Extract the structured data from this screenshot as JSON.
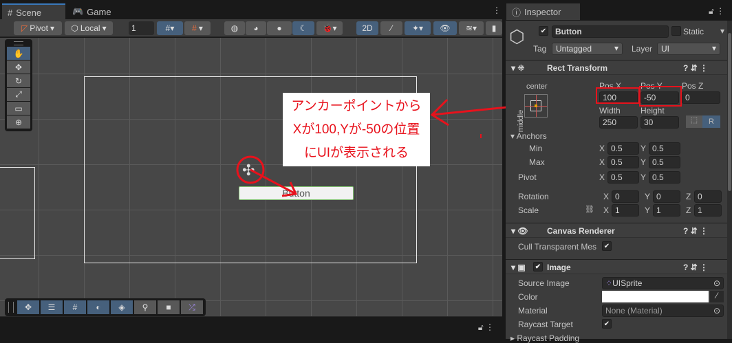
{
  "tabs": {
    "scene": "Scene",
    "game": "Game",
    "inspector": "Inspector"
  },
  "scene_toolbar": {
    "pivot": "Pivot",
    "local": "Local",
    "grid_snap_value": "1",
    "mode_2d": "2D"
  },
  "scene_view": {
    "button_text": "Button"
  },
  "annotation": {
    "line1": "アンカーポイントから",
    "line2": "Xが100,Yが-50の位置",
    "line3": "にUIが表示される",
    "color": "#e8121c"
  },
  "inspector": {
    "object_name": "Button",
    "static_label": "Static",
    "tag_label": "Tag",
    "tag_value": "Untagged",
    "layer_label": "Layer",
    "layer_value": "UI",
    "rect_transform": {
      "title": "Rect Transform",
      "anchor_h": "center",
      "anchor_v": "middle",
      "pos_x_label": "Pos X",
      "pos_y_label": "Pos Y",
      "pos_z_label": "Pos Z",
      "pos_x": "100",
      "pos_y": "-50",
      "pos_z": "0",
      "width_label": "Width",
      "height_label": "Height",
      "width": "250",
      "height": "30",
      "raw_button": "R",
      "anchors_label": "Anchors",
      "min_label": "Min",
      "max_label": "Max",
      "min_x": "0.5",
      "min_y": "0.5",
      "max_x": "0.5",
      "max_y": "0.5",
      "pivot_label": "Pivot",
      "pivot_x": "0.5",
      "pivot_y": "0.5",
      "rotation_label": "Rotation",
      "rot_x": "0",
      "rot_y": "0",
      "rot_z": "0",
      "scale_label": "Scale",
      "scale_x": "1",
      "scale_y": "1",
      "scale_z": "1",
      "x": "X",
      "y": "Y",
      "z": "Z"
    },
    "canvas_renderer": {
      "title": "Canvas Renderer",
      "cull_label": "Cull Transparent Mes"
    },
    "image": {
      "title": "Image",
      "source_label": "Source Image",
      "source_value": "UISprite",
      "color_label": "Color",
      "color_value": "#ffffff",
      "material_label": "Material",
      "material_value": "None (Material)",
      "raycast_label": "Raycast Target",
      "padding_label": "Raycast Padding"
    }
  }
}
